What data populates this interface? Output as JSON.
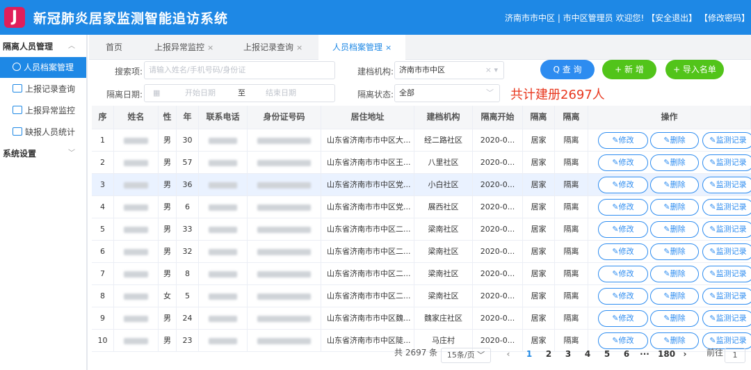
{
  "app": {
    "logo_letter": "J",
    "title": "新冠肺炎居家监测智能追访系统",
    "region_user": "济南市市中区 | 市中区管理员 欢迎您!",
    "logout": "【安全退出】",
    "change_password": "【修改密码】"
  },
  "sidebar": {
    "group1": "隔离人员管理",
    "items": [
      {
        "label": "人员档案管理"
      },
      {
        "label": "上报记录查询"
      },
      {
        "label": "上报异常监控"
      },
      {
        "label": "缺报人员统计"
      }
    ],
    "group2": "系统设置"
  },
  "tabs": [
    {
      "label": "首页"
    },
    {
      "label": "上报异常监控"
    },
    {
      "label": "上报记录查询"
    },
    {
      "label": "人员档案管理"
    }
  ],
  "tab_close": "×",
  "search": {
    "keyword_label": "搜索项:",
    "keyword_placeholder": "请输入姓名/手机号码/身份证",
    "org_label": "建档机构:",
    "org_value": "济南市市中区",
    "date_label": "隔离日期:",
    "start_placeholder": "开始日期",
    "to": "至",
    "end_placeholder": "结束日期",
    "status_label": "隔离状态:",
    "status_value": "全部",
    "query_btn": "Q 查 询",
    "add_btn": "+ 新 增",
    "import_btn": "+ 导入名单",
    "total": "共计建册2697人"
  },
  "table": {
    "headers": [
      "序",
      "姓名",
      "性",
      "年",
      "联系电话",
      "身份证号码",
      "居住地址",
      "建档机构",
      "隔离开始",
      "隔离",
      "隔离",
      "操作"
    ],
    "op_edit": "✎修改",
    "op_delete": "✎删除",
    "op_record": "✎监测记录",
    "rows": [
      {
        "no": "1",
        "sex": "男",
        "age": "30",
        "addr": "山东省济南市市中区大...",
        "org": "经二路社区",
        "start": "2020-0...",
        "type": "居家",
        "state": "隔离"
      },
      {
        "no": "2",
        "sex": "男",
        "age": "57",
        "addr": "山东省济南市市中区王...",
        "org": "八里社区",
        "start": "2020-0...",
        "type": "居家",
        "state": "隔离"
      },
      {
        "no": "3",
        "sex": "男",
        "age": "36",
        "addr": "山东省济南市市中区党...",
        "org": "小白社区",
        "start": "2020-0...",
        "type": "居家",
        "state": "隔离"
      },
      {
        "no": "4",
        "sex": "男",
        "age": "6",
        "addr": "山东省济南市市中区党...",
        "org": "展西社区",
        "start": "2020-0...",
        "type": "居家",
        "state": "隔离"
      },
      {
        "no": "5",
        "sex": "男",
        "age": "33",
        "addr": "山东省济南市市中区二...",
        "org": "梁南社区",
        "start": "2020-0...",
        "type": "居家",
        "state": "隔离"
      },
      {
        "no": "6",
        "sex": "男",
        "age": "32",
        "addr": "山东省济南市市中区二...",
        "org": "梁南社区",
        "start": "2020-0...",
        "type": "居家",
        "state": "隔离"
      },
      {
        "no": "7",
        "sex": "男",
        "age": "8",
        "addr": "山东省济南市市中区二...",
        "org": "梁南社区",
        "start": "2020-0...",
        "type": "居家",
        "state": "隔离"
      },
      {
        "no": "8",
        "sex": "女",
        "age": "5",
        "addr": "山东省济南市市中区二...",
        "org": "梁南社区",
        "start": "2020-0...",
        "type": "居家",
        "state": "隔离"
      },
      {
        "no": "9",
        "sex": "男",
        "age": "24",
        "addr": "山东省济南市市中区魏...",
        "org": "魏家庄社区",
        "start": "2020-0...",
        "type": "居家",
        "state": "隔离"
      },
      {
        "no": "10",
        "sex": "男",
        "age": "23",
        "addr": "山东省济南市市中区陡...",
        "org": "马庄村",
        "start": "2020-0...",
        "type": "居家",
        "state": "隔离"
      }
    ]
  },
  "pagination": {
    "total": "共 2697 条",
    "page_size": "15条/页",
    "prev": "‹",
    "pages": [
      "1",
      "2",
      "3",
      "4",
      "5",
      "6",
      "···",
      "180"
    ],
    "current": "1",
    "next": "›",
    "goto_label": "前往",
    "goto_value": "1"
  }
}
